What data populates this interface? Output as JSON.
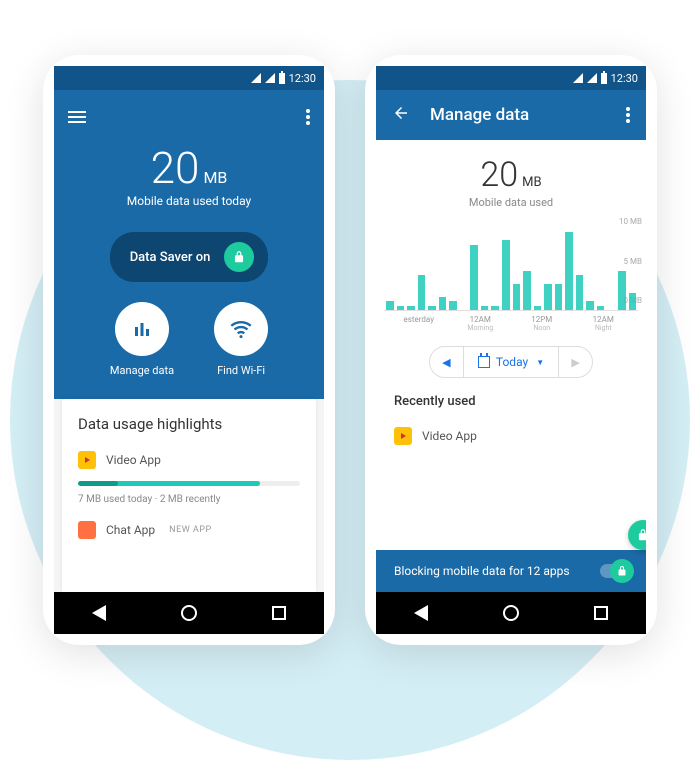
{
  "statusbar": {
    "time": "12:30"
  },
  "phone1": {
    "usage_value": "20",
    "usage_unit": "MB",
    "usage_subtitle": "Mobile data used today",
    "saver_label": "Data Saver on",
    "actions": {
      "manage": "Manage data",
      "wifi": "Find Wi-Fi"
    },
    "highlights": {
      "title": "Data usage highlights",
      "video_app": {
        "name": "Video App",
        "meta": "7 MB used today  ·  2 MB recently"
      },
      "chat_app": {
        "name": "Chat App",
        "chip": "NEW APP"
      }
    }
  },
  "phone2": {
    "title": "Manage data",
    "usage_value": "20",
    "usage_unit": "MB",
    "usage_subtitle": "Mobile data used",
    "date_label": "Today",
    "recent_title": "Recently used",
    "recent_app": "Video App",
    "blocking_msg": "Blocking mobile data for 12 apps",
    "x_axis": [
      {
        "main": "esterday",
        "sub": ""
      },
      {
        "main": "12AM",
        "sub": "Morning"
      },
      {
        "main": "12PM",
        "sub": "Noon"
      },
      {
        "main": "12AM",
        "sub": "Night"
      }
    ],
    "y_axis": [
      "10 MB",
      "5 MB",
      "0 MB"
    ]
  },
  "chart_data": {
    "type": "bar",
    "title": "Mobile data used",
    "ylabel": "MB",
    "ylim": [
      0,
      10
    ],
    "x_segments": [
      "Yesterday",
      "12AM Morning",
      "12PM Noon",
      "12AM Night"
    ],
    "values": [
      1,
      0.5,
      0.5,
      4,
      0.5,
      1.5,
      1,
      0,
      7.5,
      0.5,
      0.5,
      8,
      3,
      4.5,
      0.5,
      3,
      3,
      9,
      4,
      1,
      0.5,
      0,
      4.5,
      2
    ]
  },
  "colors": {
    "primary": "#1a6aa8",
    "primary_dark": "#105489",
    "accent": "#1dcb9e"
  }
}
